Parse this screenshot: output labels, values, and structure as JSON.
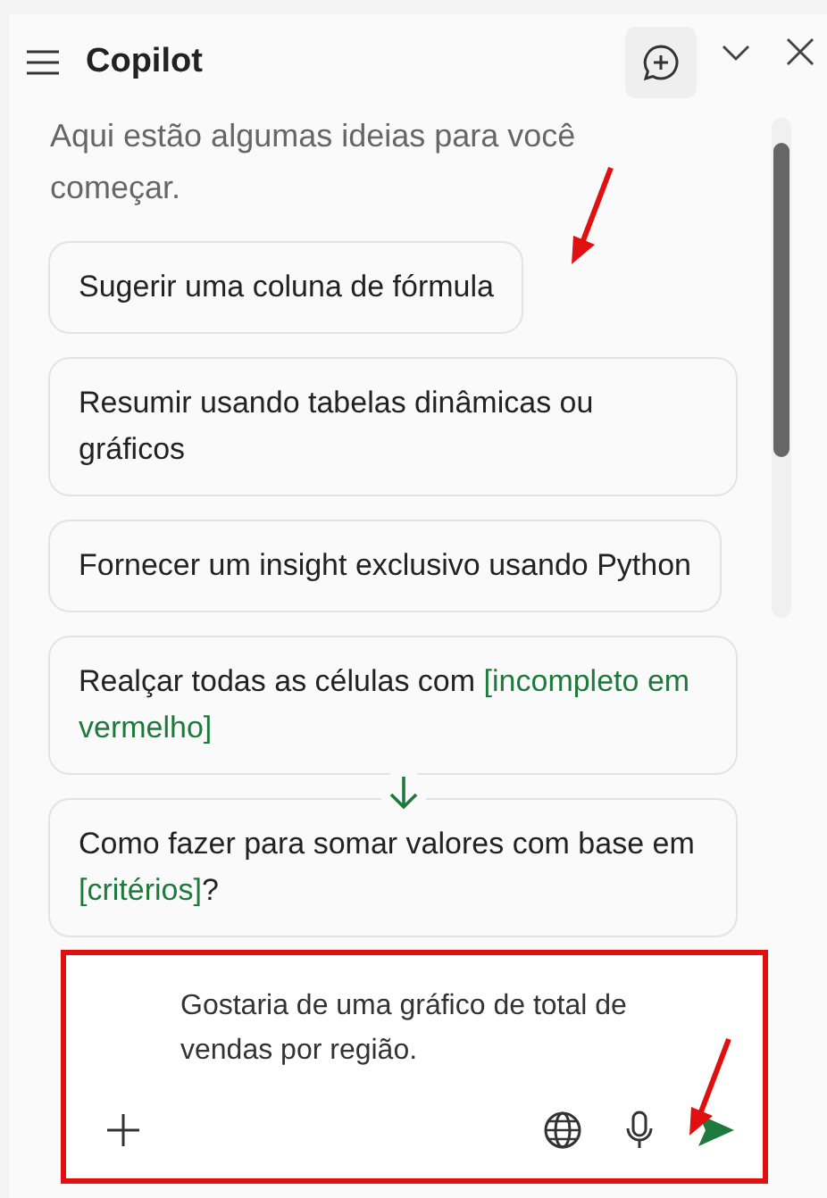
{
  "header": {
    "title": "Copilot"
  },
  "intro": "Aqui estão algumas ideias para você começar.",
  "suggestions": [
    {
      "parts": [
        {
          "kind": "plain",
          "text": "Sugerir uma coluna de fórmula"
        }
      ]
    },
    {
      "parts": [
        {
          "kind": "plain",
          "text": "Resumir usando tabelas dinâmicas ou gráficos"
        }
      ]
    },
    {
      "parts": [
        {
          "kind": "plain",
          "text": "Fornecer um insight exclusivo usando Python"
        }
      ]
    },
    {
      "parts": [
        {
          "kind": "plain",
          "text": "Realçar todas as células com "
        },
        {
          "kind": "slot",
          "text": "[incompleto em vermelho]"
        }
      ]
    },
    {
      "parts": [
        {
          "kind": "plain",
          "text": "Como fazer para somar valores com base em "
        },
        {
          "kind": "slot",
          "text": "[critérios]"
        },
        {
          "kind": "plain",
          "text": "?"
        }
      ]
    }
  ],
  "composer": {
    "value": "Gostaria de uma gráfico de total de vendas por região."
  },
  "annotations": [
    {
      "kind": "arrow"
    },
    {
      "kind": "frame"
    },
    {
      "kind": "arrow"
    }
  ]
}
